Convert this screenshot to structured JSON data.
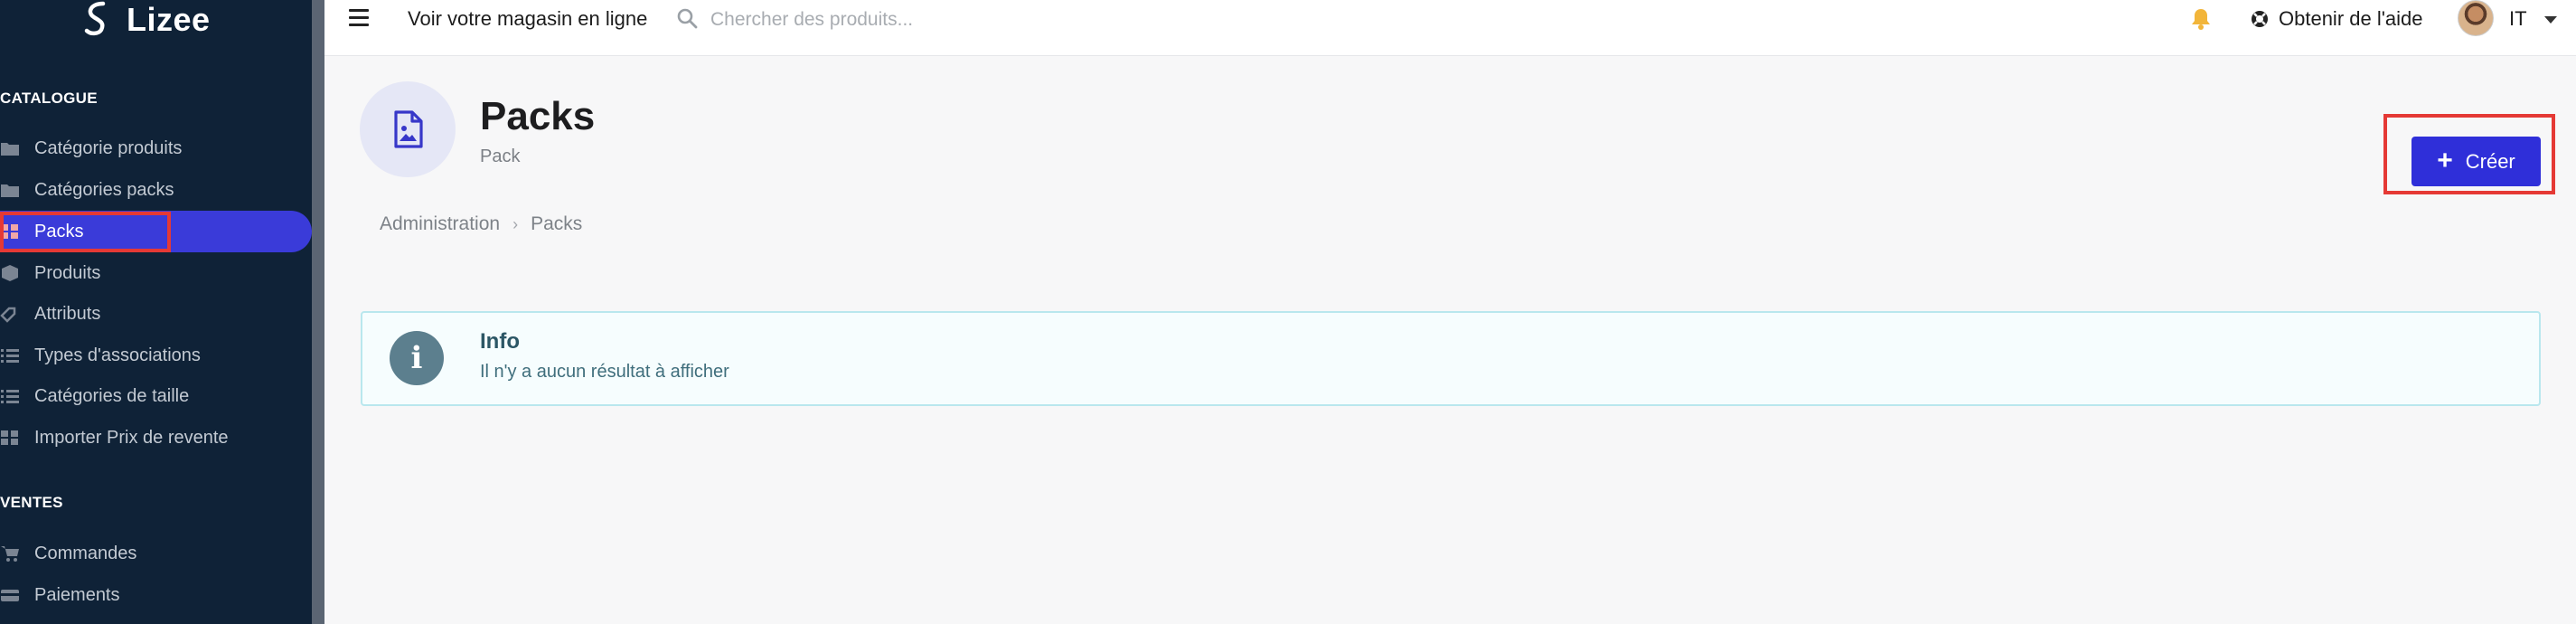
{
  "brand": {
    "name": "Lizee"
  },
  "sidebar": {
    "sections": [
      {
        "title": "CATALOGUE"
      },
      {
        "title": "VENTES"
      }
    ],
    "catalogue_items": [
      {
        "label": "Catégorie produits",
        "icon": "folder-icon"
      },
      {
        "label": "Catégories packs",
        "icon": "folder-icon"
      },
      {
        "label": "Packs",
        "icon": "packs-icon",
        "active": true
      },
      {
        "label": "Produits",
        "icon": "box-icon"
      },
      {
        "label": "Attributs",
        "icon": "attributes-icon"
      },
      {
        "label": "Types d'associations",
        "icon": "list-icon"
      },
      {
        "label": "Catégories de taille",
        "icon": "list-icon"
      },
      {
        "label": "Importer Prix de revente",
        "icon": "import-icon"
      }
    ],
    "sales_items": [
      {
        "label": "Commandes",
        "icon": "cart-icon"
      },
      {
        "label": "Paiements",
        "icon": "payment-icon"
      }
    ]
  },
  "topbar": {
    "store_link": "Voir votre magasin en ligne",
    "search_placeholder": "Chercher des produits...",
    "help_label": "Obtenir de l'aide",
    "user_initials": "IT"
  },
  "page": {
    "title": "Packs",
    "subtitle": "Pack",
    "breadcrumb": [
      "Administration",
      "Packs"
    ],
    "create_label": "Créer"
  },
  "info": {
    "title": "Info",
    "message": "Il n'y a aucun résultat à afficher"
  },
  "colors": {
    "sidebar_bg": "#0f2237",
    "accent": "#2f2fd9",
    "highlight": "#e53935",
    "info_bg": "#f6fdfe"
  }
}
